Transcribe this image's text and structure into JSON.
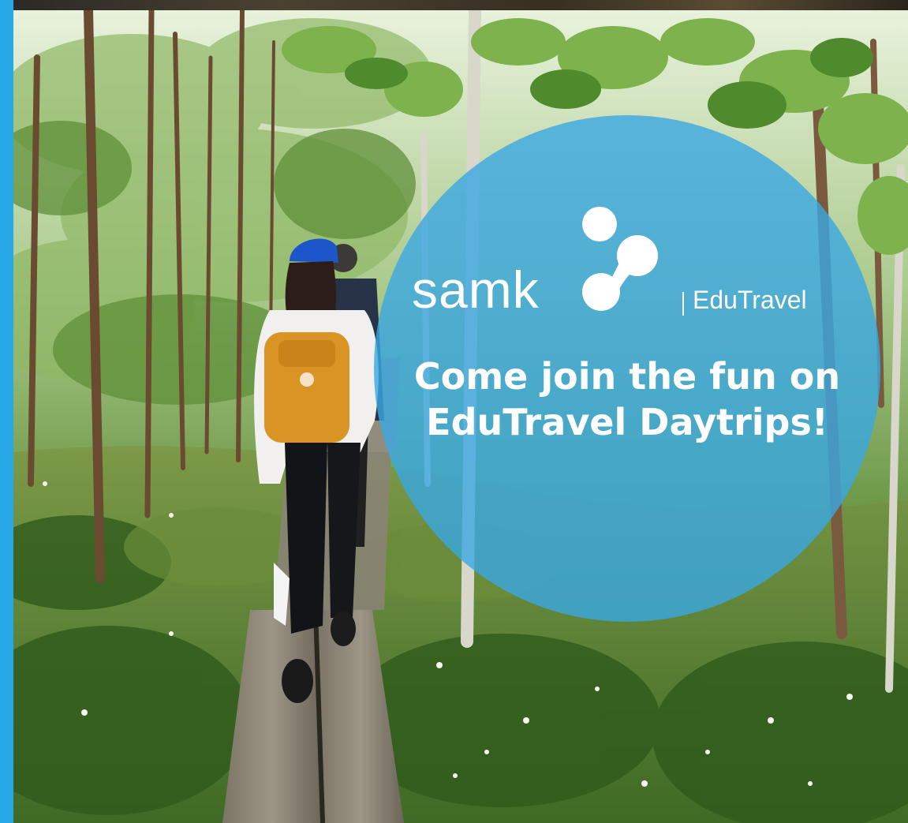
{
  "brand": {
    "logo_text": "samk",
    "product": "EduTravel",
    "accent_color": "#29a8e8",
    "badge_color": "#3aa8e2"
  },
  "headline": {
    "line1": "Come join the fun on",
    "line2": "EduTravel Daytrips!"
  },
  "photo": {
    "subject": "hikers-on-boardwalk-forest-icon"
  }
}
